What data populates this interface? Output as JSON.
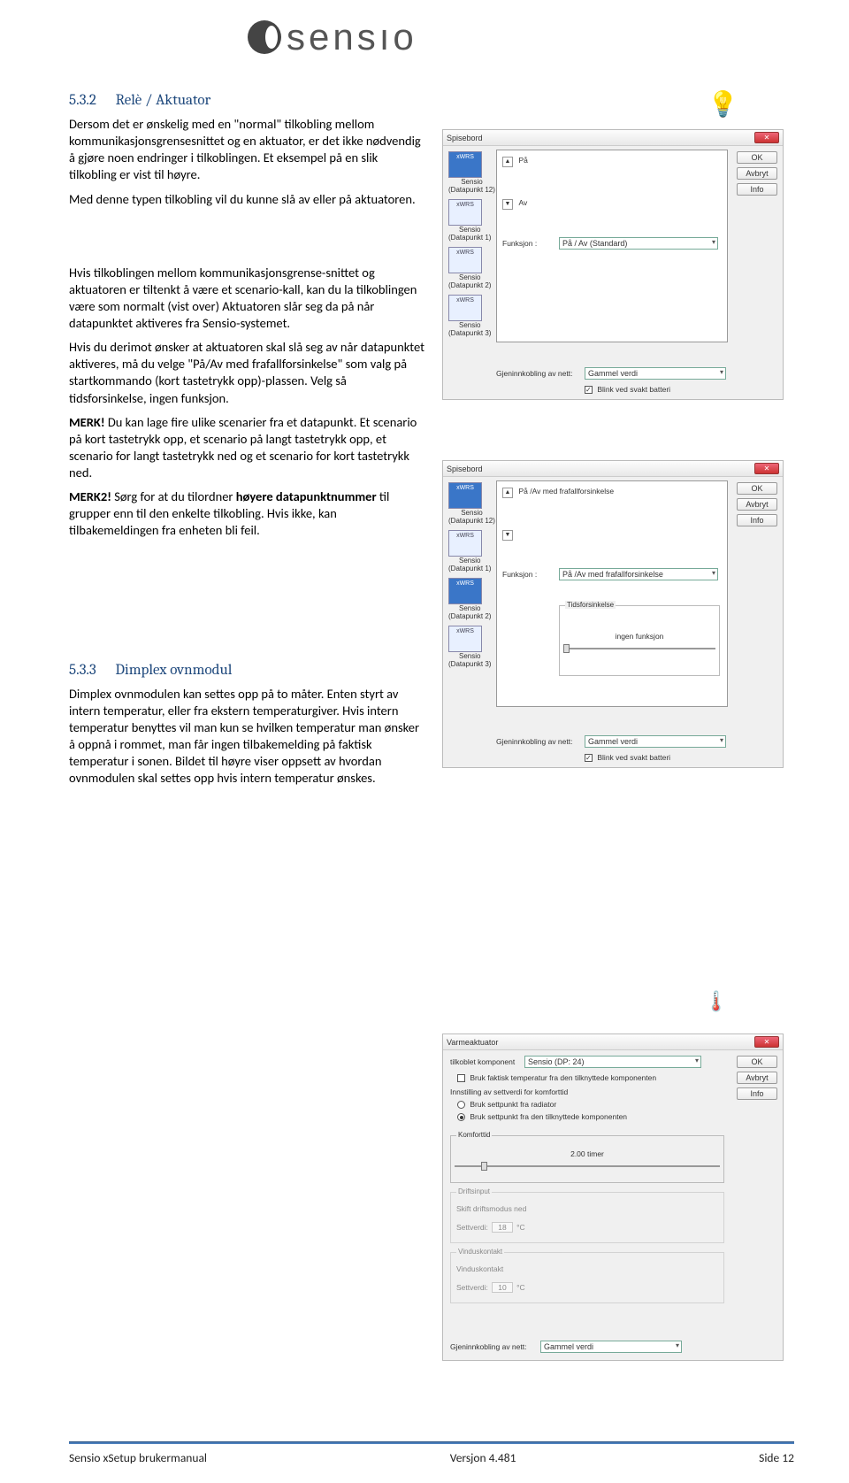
{
  "logo_text": "sensıo",
  "section_532": {
    "num": "5.3.2",
    "title": "Relè / Aktuator",
    "p1": "Dersom det er ønskelig med en \"normal\" tilkobling mellom kommunikasjonsgrensesnittet og en aktuator, er det ikke nødvendig å gjøre noen endringer i tilkoblingen. Et eksempel på en slik tilkobling er vist til høyre.",
    "p2": "Med denne typen tilkobling vil du kunne slå av eller på aktuatoren.",
    "p3": "Hvis tilkoblingen mellom kommunikasjonsgrense-snittet og aktuatoren er tiltenkt å være et scenario-kall, kan du la tilkoblingen være som normalt (vist over) Aktuatoren slår seg da på når datapunktet aktiveres fra Sensio-systemet.",
    "p4": "Hvis du derimot ønsker at aktuatoren skal slå seg av når datapunktet aktiveres, må du velge \"På/Av med frafallforsinkelse\" som valg på startkommando (kort tastetrykk opp)-plassen. Velg så tidsforsinkelse, ingen funksjon.",
    "merk_label": "MERK!",
    "merk_text": " Du kan lage fire ulike scenarier fra et datapunkt. Et scenario på kort tastetrykk opp, et scenario på langt tastetrykk opp, et scenario for langt tastetrykk ned og et scenario for kort tastetrykk ned.",
    "merk2_label": "MERK2!",
    "merk2_a": " Sørg for at du tilordner ",
    "merk2_bold": "høyere datapunktnummer",
    "merk2_b": " til grupper enn til den enkelte tilkobling. Hvis ikke, kan tilbakemeldingen fra enheten bli feil."
  },
  "section_533": {
    "num": "5.3.3",
    "title": "Dimplex ovnmodul",
    "p1": "Dimplex ovnmodulen kan settes opp på to måter. Enten styrt av intern temperatur, eller fra ekstern temperaturgiver. Hvis intern temperatur benyttes vil man kun se hvilken temperatur man ønsker å oppnå i rommet, man får ingen tilbakemelding på faktisk temperatur i sonen. Bildet til høyre viser oppsett av hvordan ovnmodulen skal settes opp hvis intern temperatur ønskes."
  },
  "dialog1": {
    "title": "Spisebord",
    "dp12": "Sensio",
    "dp12b": "(Datapunkt 12)",
    "dp1": "Sensio",
    "dp1b": "(Datapunkt 1)",
    "dp2": "Sensio",
    "dp2b": "(Datapunkt 2)",
    "dp3": "Sensio",
    "dp3b": "(Datapunkt 3)",
    "pa": "På",
    "av": "Av",
    "funksjon": "Funksjon :",
    "funksjon_val": "På / Av (Standard)",
    "gjen": "Gjeninnkobling av nett:",
    "gjen_val": "Gammel verdi",
    "blink": "Blink ved svakt batteri",
    "ok": "OK",
    "avbryt": "Avbryt",
    "info": "Info"
  },
  "dialog2": {
    "title": "Spisebord",
    "pa": "På /Av med frafallforsinkelse",
    "funksjon": "Funksjon :",
    "funksjon_val": "På /Av med frafallforsinkelse",
    "tids": "Tidsforsinkelse",
    "ingen": "ingen funksjon",
    "gjen": "Gjeninnkobling av nett:",
    "gjen_val": "Gammel verdi",
    "blink": "Blink ved svakt batteri",
    "ok": "OK",
    "avbryt": "Avbryt",
    "info": "Info"
  },
  "dialog3": {
    "title": "Varmeaktuator",
    "tilkoblet": "tilkoblet komponent",
    "tilkoblet_val": "Sensio  (DP: 24)",
    "bruk_faktisk": "Bruk faktisk temperatur fra den tilknyttede komponenten",
    "innstilling": "Innstilling av settverdi for komforttid",
    "r1": "Bruk settpunkt fra radiator",
    "r2": "Bruk settpunkt fra den tilknyttede komponenten",
    "komfort": "Komforttid",
    "timer": "2.00 timer",
    "drifts": "Driftsinput",
    "skift": "Skift driftsmodus ned",
    "settverdi": "Settverdi:",
    "settverdi_val": "18",
    "c": "°C",
    "vindus": "Vinduskontakt",
    "vinduskont": "Vinduskontakt",
    "settverdi2": "Settverdi:",
    "settverdi2_val": "10",
    "gjen": "Gjeninnkobling av nett:",
    "gjen_val": "Gammel verdi",
    "ok": "OK",
    "avbryt": "Avbryt",
    "info": "Info"
  },
  "footer": {
    "left": "Sensio xSetup brukermanual",
    "center": "Versjon 4.481",
    "right": "Side 12"
  }
}
